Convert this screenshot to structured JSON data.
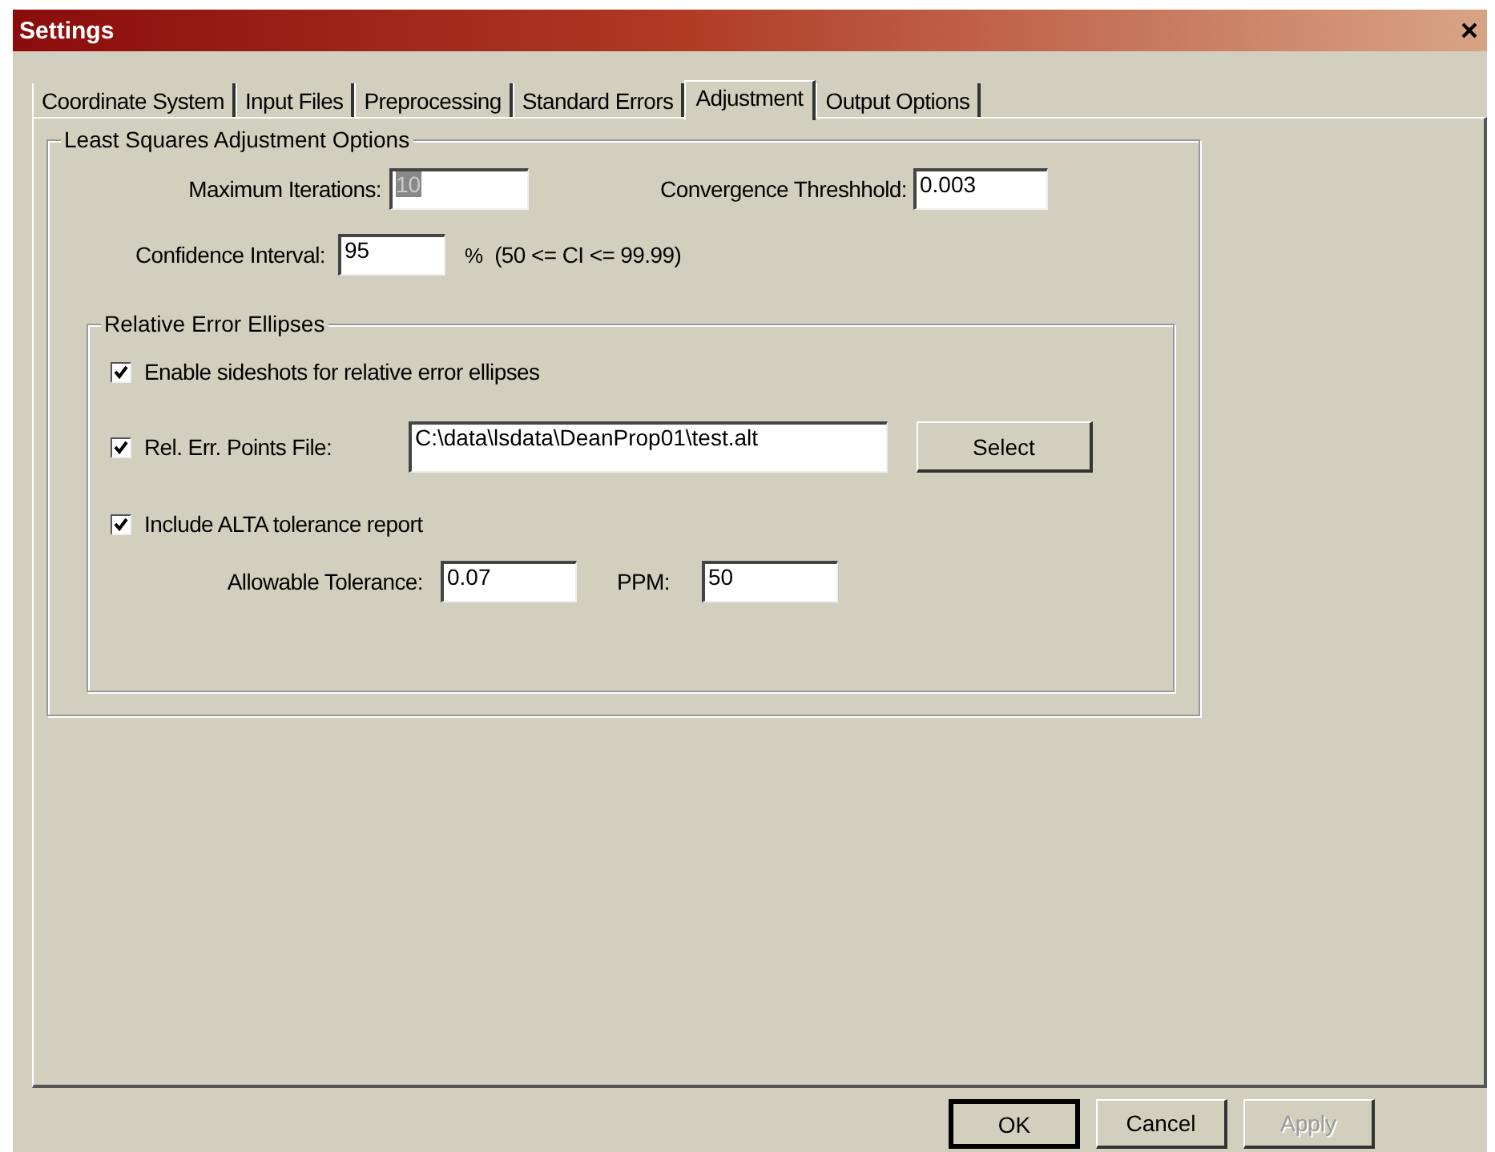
{
  "window": {
    "title": "Settings"
  },
  "tabs": [
    {
      "label": "Coordinate System",
      "selected": false
    },
    {
      "label": "Input Files",
      "selected": false
    },
    {
      "label": "Preprocessing",
      "selected": false
    },
    {
      "label": "Standard Errors",
      "selected": false
    },
    {
      "label": "Adjustment",
      "selected": true
    },
    {
      "label": "Output Options",
      "selected": false
    }
  ],
  "group": {
    "title": "Least Squares Adjustment Options",
    "iteration_row": [
      {
        "label": "Maximum Iterations:",
        "value": "10",
        "text_selected": true
      },
      {
        "label": "Convergence Threshhold:",
        "value": "0.003",
        "text_selected": false
      }
    ],
    "confidence": {
      "label": "Confidence Interval:",
      "value": "95",
      "unit": "%",
      "range": "(50 <= CI <= 99.99)"
    },
    "subgroup": {
      "title": "Relative Error Ellipses",
      "options": [
        {
          "kind": "checkbox",
          "label": "Enable sideshots for relative error ellipses",
          "checked": true
        },
        {
          "kind": "file",
          "label": "Rel. Err. Points File:",
          "checked": true,
          "value": "C:\\data\\lsdata\\DeanProp01\\test.alt",
          "button": "Select"
        },
        {
          "kind": "checkbox",
          "label": "Include ALTA tolerance report",
          "checked": true
        }
      ],
      "tolerance_row": [
        {
          "label": "Allowable Tolerance:",
          "value": "0.07"
        },
        {
          "label": "PPM:",
          "value": "50"
        }
      ]
    }
  },
  "buttons": [
    {
      "label": "OK",
      "default": true,
      "disabled": false
    },
    {
      "label": "Cancel",
      "default": false,
      "disabled": false
    },
    {
      "label": "Apply",
      "default": false,
      "disabled": true
    }
  ]
}
